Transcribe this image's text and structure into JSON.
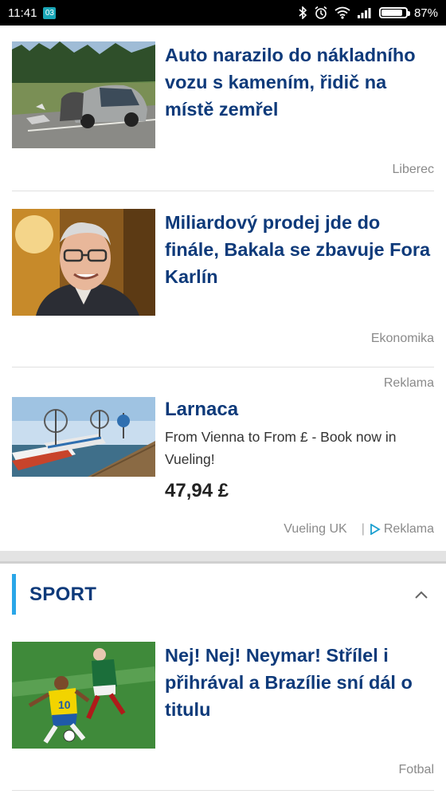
{
  "status_bar": {
    "time": "11:41",
    "notification_badge": "03",
    "battery": "87%",
    "battery_level": 0.87
  },
  "articles": [
    {
      "headline": "Auto narazilo do nákladního vozu s kamením, řidič na místě zemřel",
      "category": "Liberec",
      "image": "car-crash-photo"
    },
    {
      "headline": "Miliardový prodej jde do finále, Bakala se zbavuje Fora Karlín",
      "category": "Ekonomika",
      "image": "portrait-photo"
    }
  ],
  "ad": {
    "label_top": "Reklama",
    "title": "Larnaca",
    "description": "From Vienna to From £ - Book now in Vueling!",
    "price": "47,94 £",
    "advertiser": "Vueling UK",
    "separator": "|",
    "label_bottom": "Reklama",
    "image": "harbor-boats-photo"
  },
  "sport_section": {
    "title": "SPORT",
    "accent_color": "#2aa6e8",
    "article": {
      "headline": "Nej! Nej! Neymar! Střílel i přihrával a Brazílie sní dál o titulu",
      "category": "Fotbal",
      "image": "football-match-photo"
    }
  },
  "colors": {
    "headline": "#0e3a7a",
    "meta": "#8a8a8a"
  }
}
